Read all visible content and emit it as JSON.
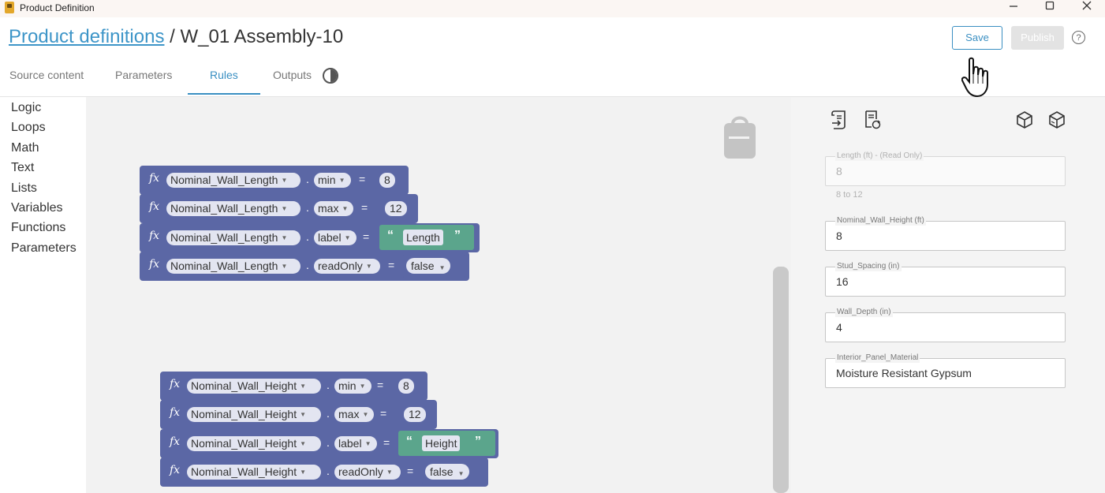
{
  "window": {
    "title": "Product Definition",
    "minimize_icon": "minimize-icon",
    "maximize_icon": "maximize-icon",
    "close_icon": "close-icon"
  },
  "header": {
    "breadcrumb_link": "Product definitions",
    "breadcrumb_separator": " / ",
    "breadcrumb_current": "W_01 Assembly-10",
    "save_label": "Save",
    "publish_label": "Publish",
    "help_icon": "help-circle-icon",
    "help_glyph": "?"
  },
  "tabs": [
    {
      "label": "Source content",
      "active": false
    },
    {
      "label": "Parameters",
      "active": false
    },
    {
      "label": "Rules",
      "active": true
    },
    {
      "label": "Outputs",
      "active": false
    }
  ],
  "categories": [
    "Logic",
    "Loops",
    "Math",
    "Text",
    "Lists",
    "Variables",
    "Functions",
    "Parameters"
  ],
  "rule_groups": [
    {
      "rows": [
        {
          "fx": "fx",
          "parameter": "Nominal_Wall_Length",
          "dot": ".",
          "property": "min",
          "op": "=",
          "value": "8",
          "kind": "number"
        },
        {
          "fx": "fx",
          "parameter": "Nominal_Wall_Length",
          "dot": ".",
          "property": "max",
          "op": "=",
          "value": "12",
          "kind": "number"
        },
        {
          "fx": "fx",
          "parameter": "Nominal_Wall_Length",
          "dot": ".",
          "property": "label",
          "op": "=",
          "value": "Length",
          "kind": "string",
          "open_quote": "“",
          "close_quote": "”"
        },
        {
          "fx": "fx",
          "parameter": "Nominal_Wall_Length",
          "dot": ".",
          "property": "readOnly",
          "op": "=",
          "value": "false",
          "kind": "boolean"
        }
      ]
    },
    {
      "rows": [
        {
          "fx": "fx",
          "parameter": "Nominal_Wall_Height",
          "dot": ".",
          "property": "min",
          "op": "=",
          "value": "8",
          "kind": "number"
        },
        {
          "fx": "fx",
          "parameter": "Nominal_Wall_Height",
          "dot": ".",
          "property": "max",
          "op": "=",
          "value": "12",
          "kind": "number"
        },
        {
          "fx": "fx",
          "parameter": "Nominal_Wall_Height",
          "dot": ".",
          "property": "label",
          "op": "=",
          "value": "Height",
          "kind": "string",
          "open_quote": "“",
          "close_quote": "”"
        },
        {
          "fx": "fx",
          "parameter": "Nominal_Wall_Height",
          "dot": ".",
          "property": "readOnly",
          "op": "=",
          "value": "false",
          "kind": "boolean"
        }
      ]
    }
  ],
  "preview": {
    "toolbar_icons": [
      "document-export-icon",
      "document-refresh-icon",
      "cube-icon",
      "cube-reset-icon"
    ],
    "fields": [
      {
        "label": "Length (ft) - (Read Only)",
        "value": "8",
        "readonly": true,
        "hint": "8 to 12"
      },
      {
        "label": "Nominal_Wall_Height (ft)",
        "value": "8",
        "readonly": false
      },
      {
        "label": "Stud_Spacing (in)",
        "value": "16",
        "readonly": false
      },
      {
        "label": "Wall_Depth (in)",
        "value": "4",
        "readonly": false
      },
      {
        "label": "Interior_Panel_Material",
        "value": "Moisture Resistant Gypsum",
        "readonly": false
      }
    ]
  },
  "colors": {
    "accent": "#3a8fc2",
    "block_blue": "#5b67a5",
    "block_green": "#5ba58c",
    "workspace_bg": "#f2f2f2"
  }
}
